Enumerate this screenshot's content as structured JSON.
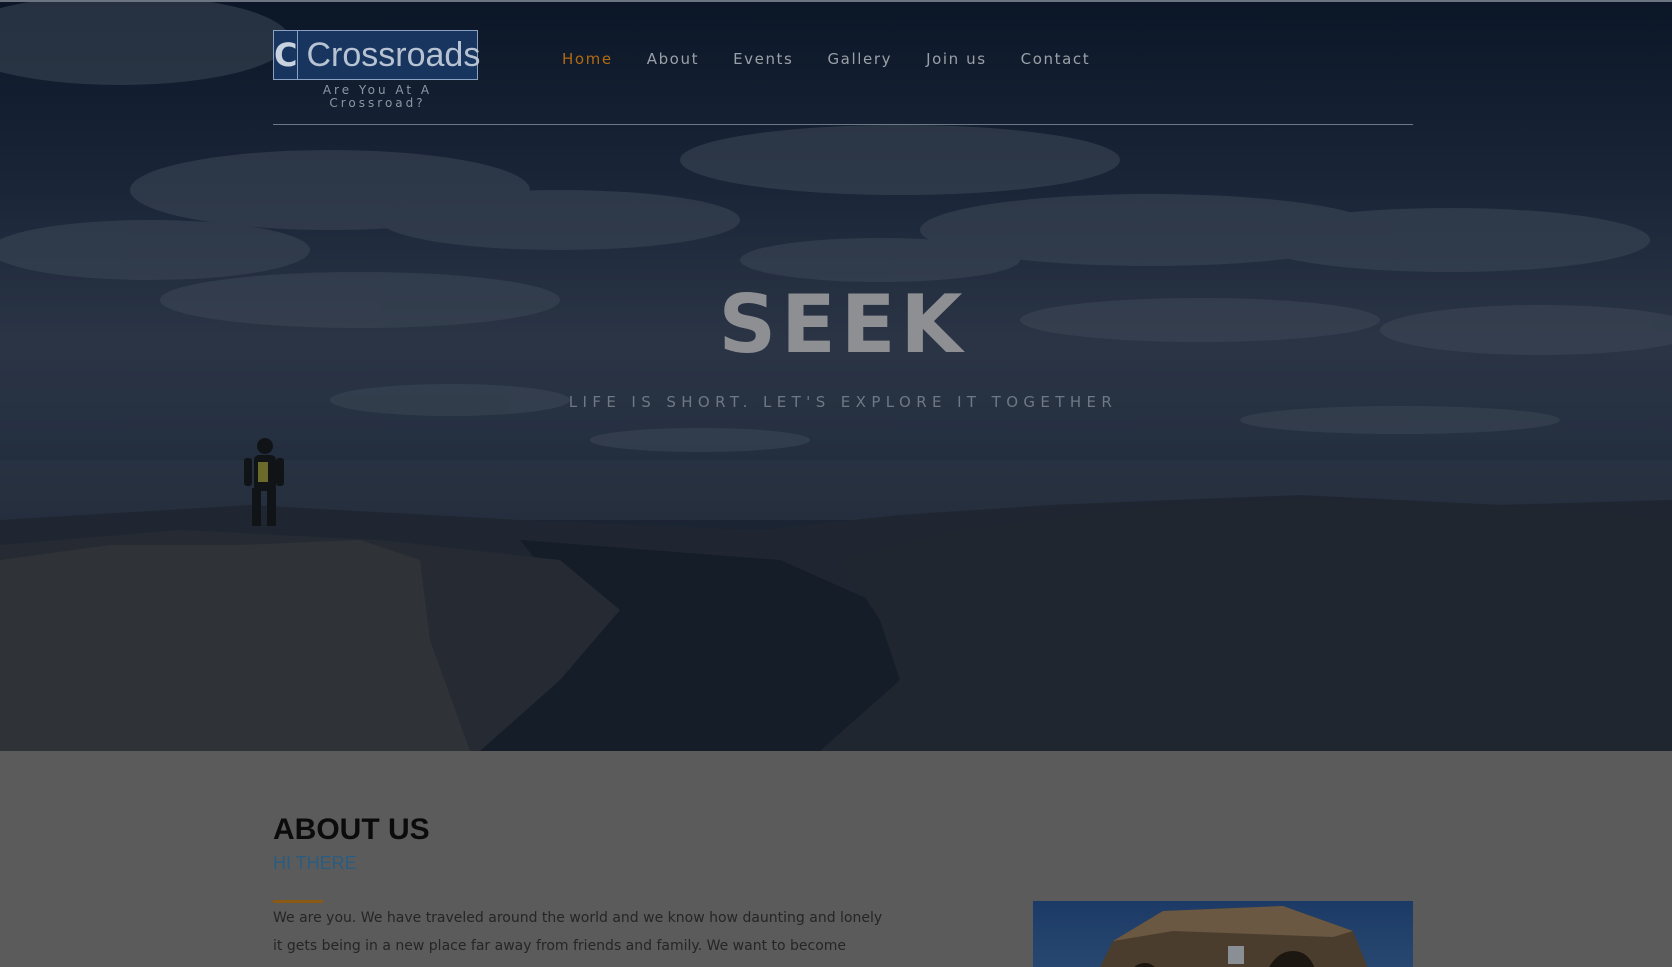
{
  "brand": {
    "logo_letter": "C",
    "name": "Crossroads",
    "tagline": "Are You At A Crossroad?"
  },
  "nav": {
    "items": [
      {
        "label": "Home",
        "active": true
      },
      {
        "label": "About",
        "active": false
      },
      {
        "label": "Events",
        "active": false
      },
      {
        "label": "Gallery",
        "active": false
      },
      {
        "label": "Join us",
        "active": false
      },
      {
        "label": "Contact",
        "active": false
      }
    ]
  },
  "hero": {
    "title": "SEEK",
    "subtitle": "LIFE IS SHORT. LET'S EXPLORE IT TOGETHER"
  },
  "about": {
    "title": "ABOUT US",
    "subtitle": "HI THERE",
    "text": "We are you. We have traveled around the world and we know how daunting and lonely it gets being in a new place far away from friends and family. We want to become friends with you in this journey of life."
  },
  "colors": {
    "accent": "#b26a12",
    "brand_blue": "#17355e",
    "subtitle_blue": "#2a5c80"
  }
}
